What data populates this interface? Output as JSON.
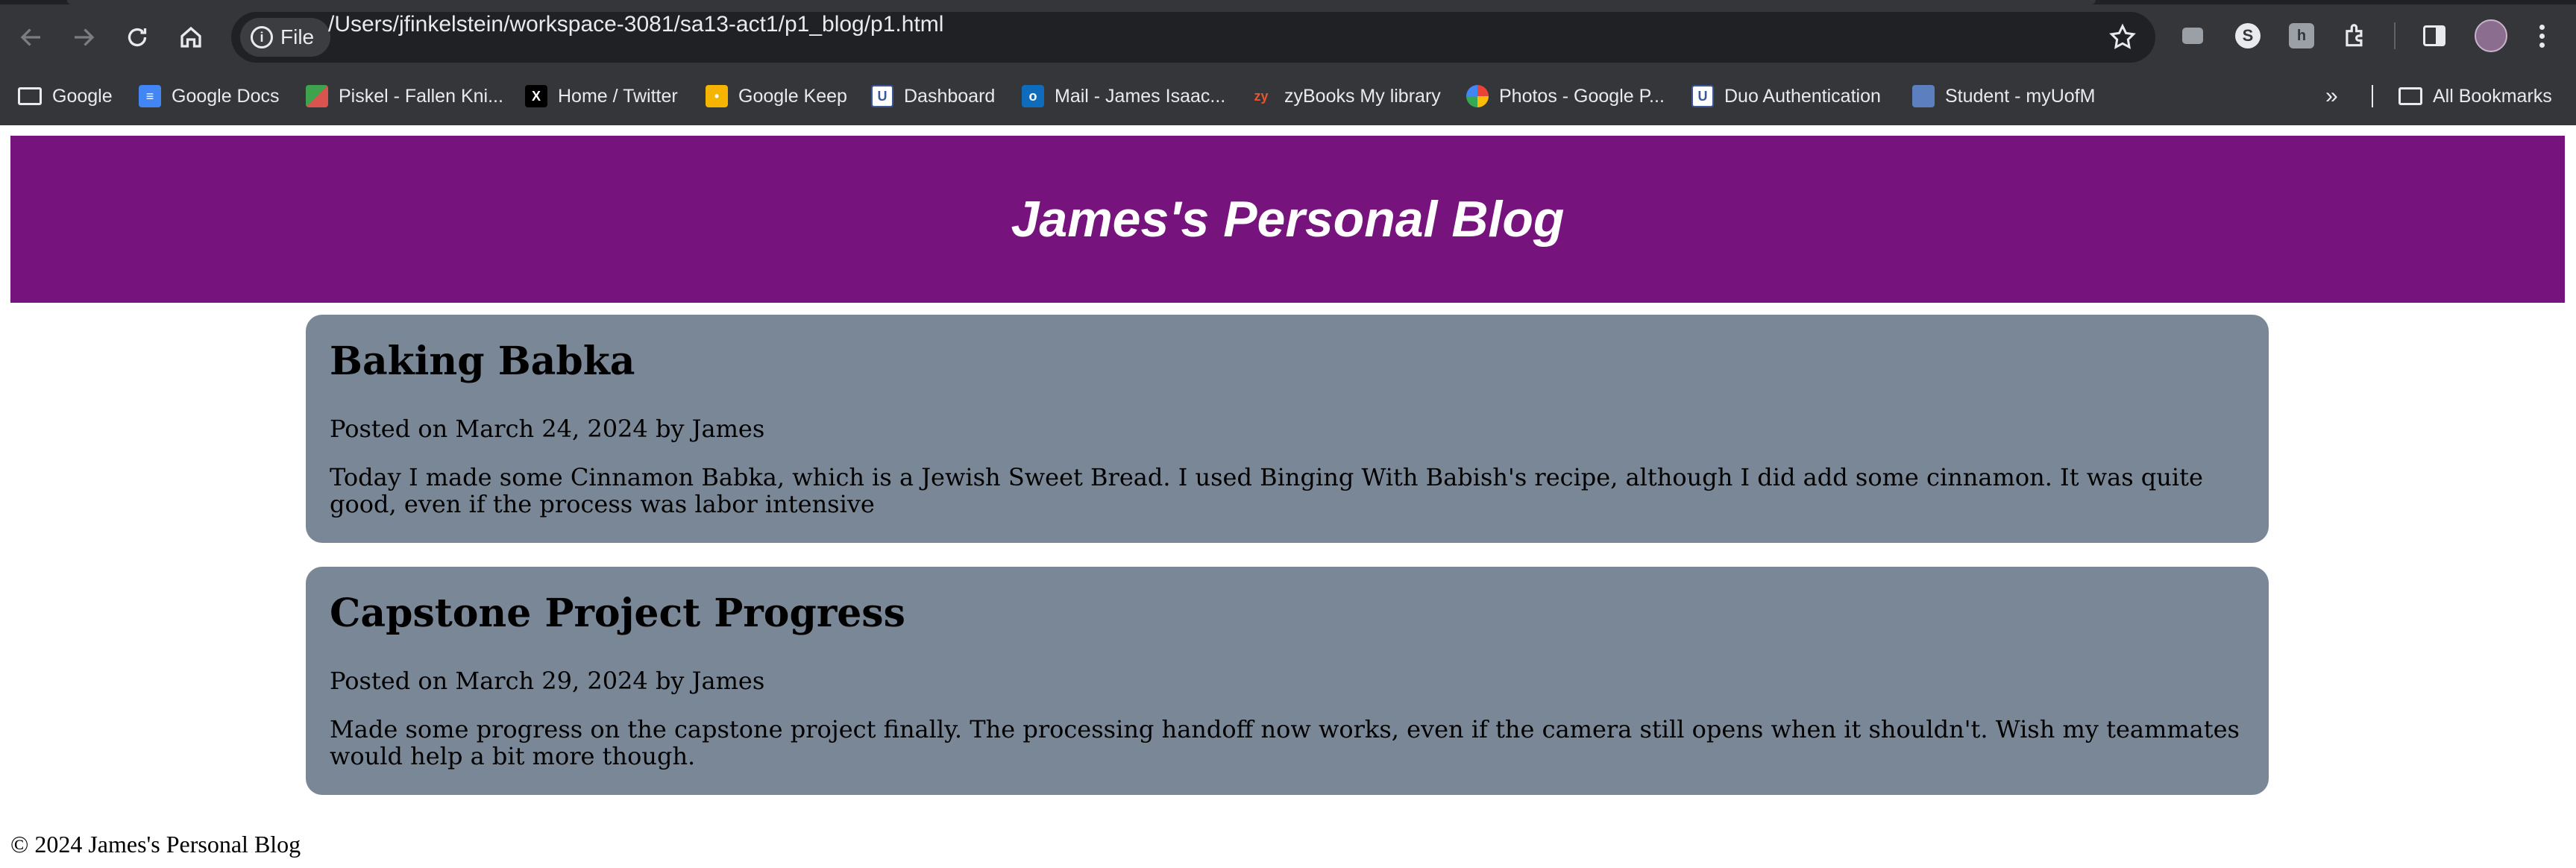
{
  "browser": {
    "url_chip": "File",
    "url": "/Users/jfinkelstein/workspace-3081/sa13-act1/p1_blog/p1.html",
    "bookmarks": [
      {
        "label": "Google",
        "icon": "folder-icon"
      },
      {
        "label": "Google Docs",
        "icon": "google-docs-icon",
        "color": "#4285f4"
      },
      {
        "label": "Piskel - Fallen Kni...",
        "icon": "piskel-icon",
        "color": "#3fa34d"
      },
      {
        "label": "Home / Twitter",
        "icon": "x-icon",
        "color": "#000000"
      },
      {
        "label": "Google Keep",
        "icon": "google-keep-icon",
        "color": "#f4b400"
      },
      {
        "label": "Dashboard",
        "icon": "dashboard-icon",
        "color": "#3b5998"
      },
      {
        "label": "Mail - James Isaac...",
        "icon": "outlook-icon",
        "color": "#0f6cbd"
      },
      {
        "label": "zyBooks My library",
        "icon": "zybooks-icon",
        "color": "#e4572e"
      },
      {
        "label": "Photos - Google P...",
        "icon": "google-photos-icon",
        "color": "#ea4335"
      },
      {
        "label": "Duo Authentication",
        "icon": "duo-icon",
        "color": "#3b5998"
      },
      {
        "label": "Student - myUofM",
        "icon": "student-icon",
        "color": "#5b7fbf"
      }
    ],
    "all_bookmarks": "All Bookmarks"
  },
  "page": {
    "title": "James's Personal Blog",
    "header_color": "#76137c",
    "post_color": "#7a8797",
    "posts": [
      {
        "title": "Baking Babka",
        "meta": "Posted on March 24, 2024 by James",
        "body": "Today I made some Cinnamon Babka, which is a Jewish Sweet Bread. I used Binging With Babish's recipe, although I did add some cinnamon. It was quite good, even if the process was labor intensive"
      },
      {
        "title": "Capstone Project Progress",
        "meta": "Posted on March 29, 2024 by James",
        "body": "Made some progress on the capstone project finally. The processing handoff now works, even if the camera still opens when it shouldn't. Wish my teammates would help a bit more though."
      }
    ],
    "footer": "© 2024 James's Personal Blog"
  }
}
